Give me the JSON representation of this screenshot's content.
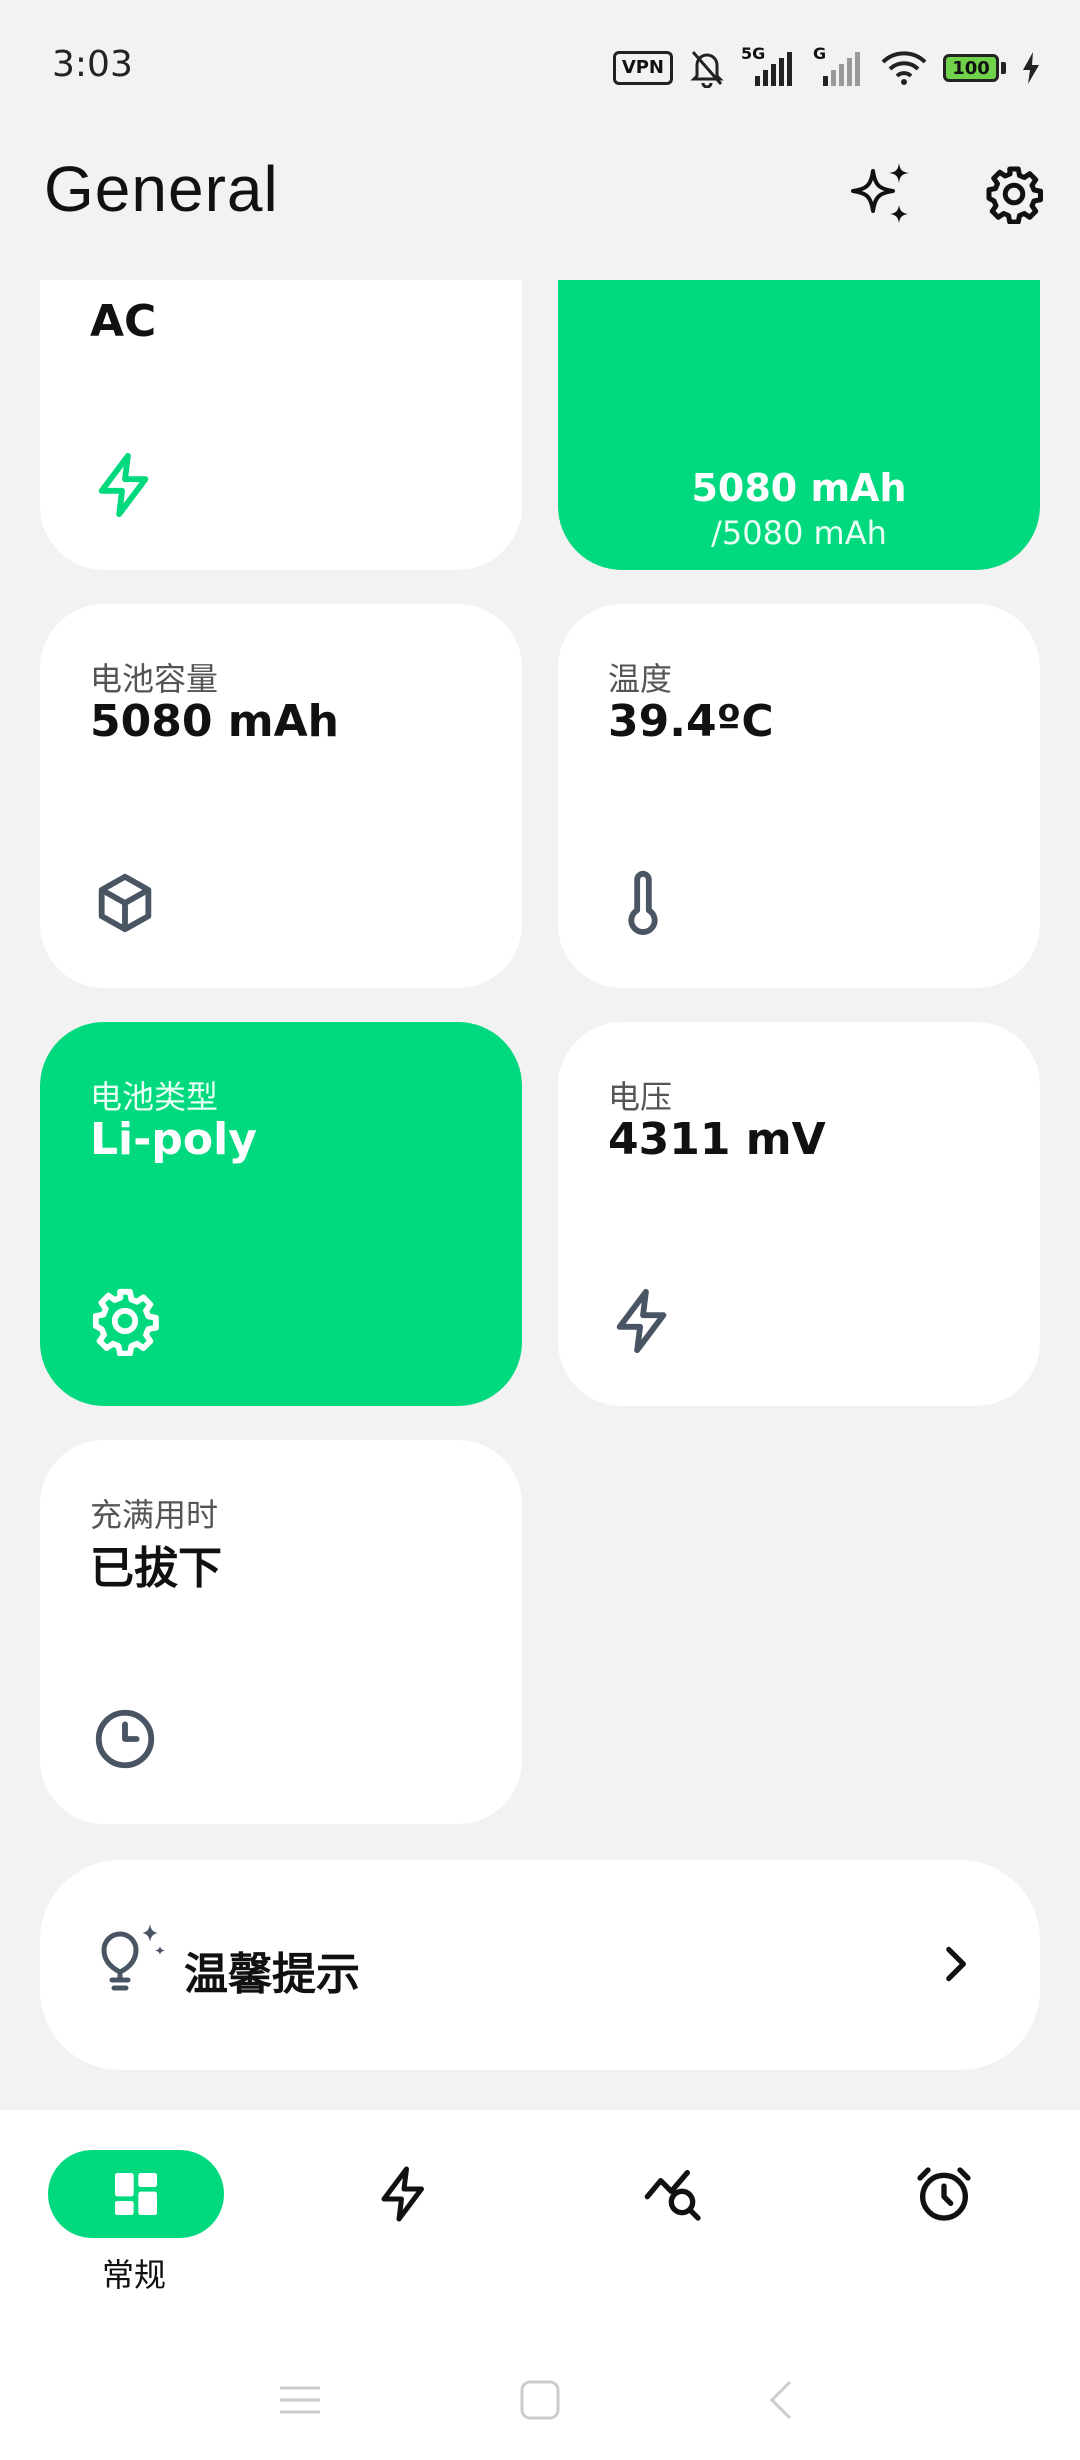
{
  "status_bar": {
    "time": "3:03",
    "vpn": "VPN",
    "network_1": "5G",
    "network_2": "G",
    "battery_level": "100",
    "icons": [
      "vpn-icon",
      "mute-bell-icon",
      "signal-5g-icon",
      "signal-g-icon",
      "wifi-icon",
      "battery-icon",
      "charging-bolt-icon"
    ]
  },
  "header": {
    "title": "General",
    "actions": [
      "sparkles-icon",
      "gear-icon"
    ]
  },
  "cards": [
    {
      "id": "power-source",
      "label": "",
      "value": "AC",
      "icon": "bolt-icon",
      "accent": false
    },
    {
      "id": "charge-level",
      "value": "5080 mAh",
      "subvalue": "/5080 mAh",
      "accent": true
    },
    {
      "id": "battery-capacity",
      "label": "电池容量",
      "value": "5080 mAh",
      "icon": "cube-icon",
      "accent": false
    },
    {
      "id": "temperature",
      "label": "温度",
      "value": "39.4ºC",
      "icon": "thermometer-icon",
      "accent": false
    },
    {
      "id": "battery-type",
      "label": "电池类型",
      "value": "Li-poly",
      "icon": "gear-icon",
      "accent": true
    },
    {
      "id": "voltage",
      "label": "电压",
      "value": "4311 mV",
      "icon": "bolt-icon",
      "accent": false
    },
    {
      "id": "charge-time",
      "label": "充满用时",
      "value": "已拔下",
      "icon": "clock-icon",
      "accent": false
    }
  ],
  "tips": {
    "label": "温馨提示",
    "icon": "lightbulb-sparkle-icon"
  },
  "bottom_nav": {
    "items": [
      {
        "id": "general",
        "label": "常规",
        "icon": "dashboard-icon",
        "active": true
      },
      {
        "id": "charging",
        "label": "",
        "icon": "bolt-icon",
        "active": false
      },
      {
        "id": "analytics",
        "label": "",
        "icon": "chart-search-icon",
        "active": false
      },
      {
        "id": "alarm",
        "label": "",
        "icon": "alarm-icon",
        "active": false
      }
    ]
  },
  "colors": {
    "accent": "#00d97e",
    "background": "#f2f2f2",
    "card": "#ffffff",
    "icon_gray": "#4a5563"
  }
}
